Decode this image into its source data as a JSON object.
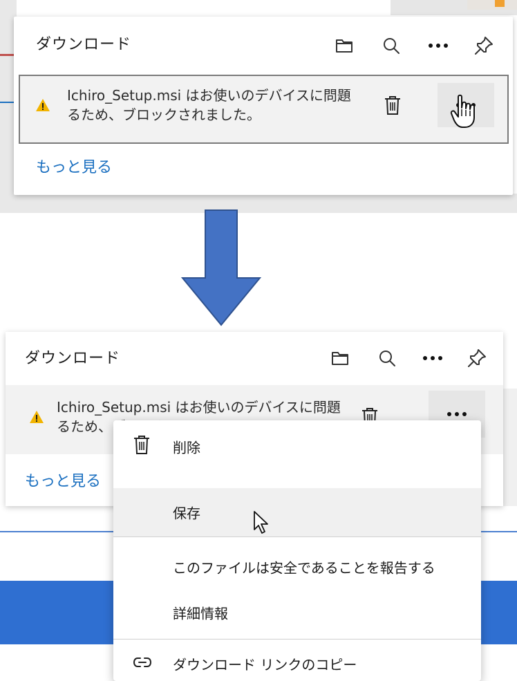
{
  "before": {
    "title": "ダウンロード",
    "download_item": {
      "line1": "Ichiro_Setup.msi はお使いのデバイスに問題",
      "line2": "るため、ブロックされました。"
    },
    "more_link": "もっと見る"
  },
  "after": {
    "title": "ダウンロード",
    "download_item": {
      "line1": "Ichiro_Setup.msi はお使いのデバイスに問題",
      "line2": "るため、ブロックされました。"
    },
    "more_link": "もっと見る",
    "context_menu": {
      "items": [
        {
          "label": "削除",
          "icon": "trash-icon"
        },
        {
          "label": "保存",
          "icon": ""
        },
        {
          "label": "このファイルは安全であることを報告する",
          "icon": ""
        },
        {
          "label": "詳細情報",
          "icon": ""
        },
        {
          "label": "ダウンロード リンクのコピー",
          "icon": "link-icon"
        }
      ],
      "highlighted_index": 1
    }
  },
  "icons": {
    "header": [
      "folder-icon",
      "search-icon",
      "more-icon",
      "pin-icon"
    ],
    "warning": "warning-icon"
  },
  "colors": {
    "link": "#1a6fc0",
    "warning": "#f2b400",
    "arrow": "#4472c4",
    "arrow_stroke": "#2f528f",
    "hover_bg": "#e6e6e6",
    "menu_highlight": "#f0f0f0"
  }
}
